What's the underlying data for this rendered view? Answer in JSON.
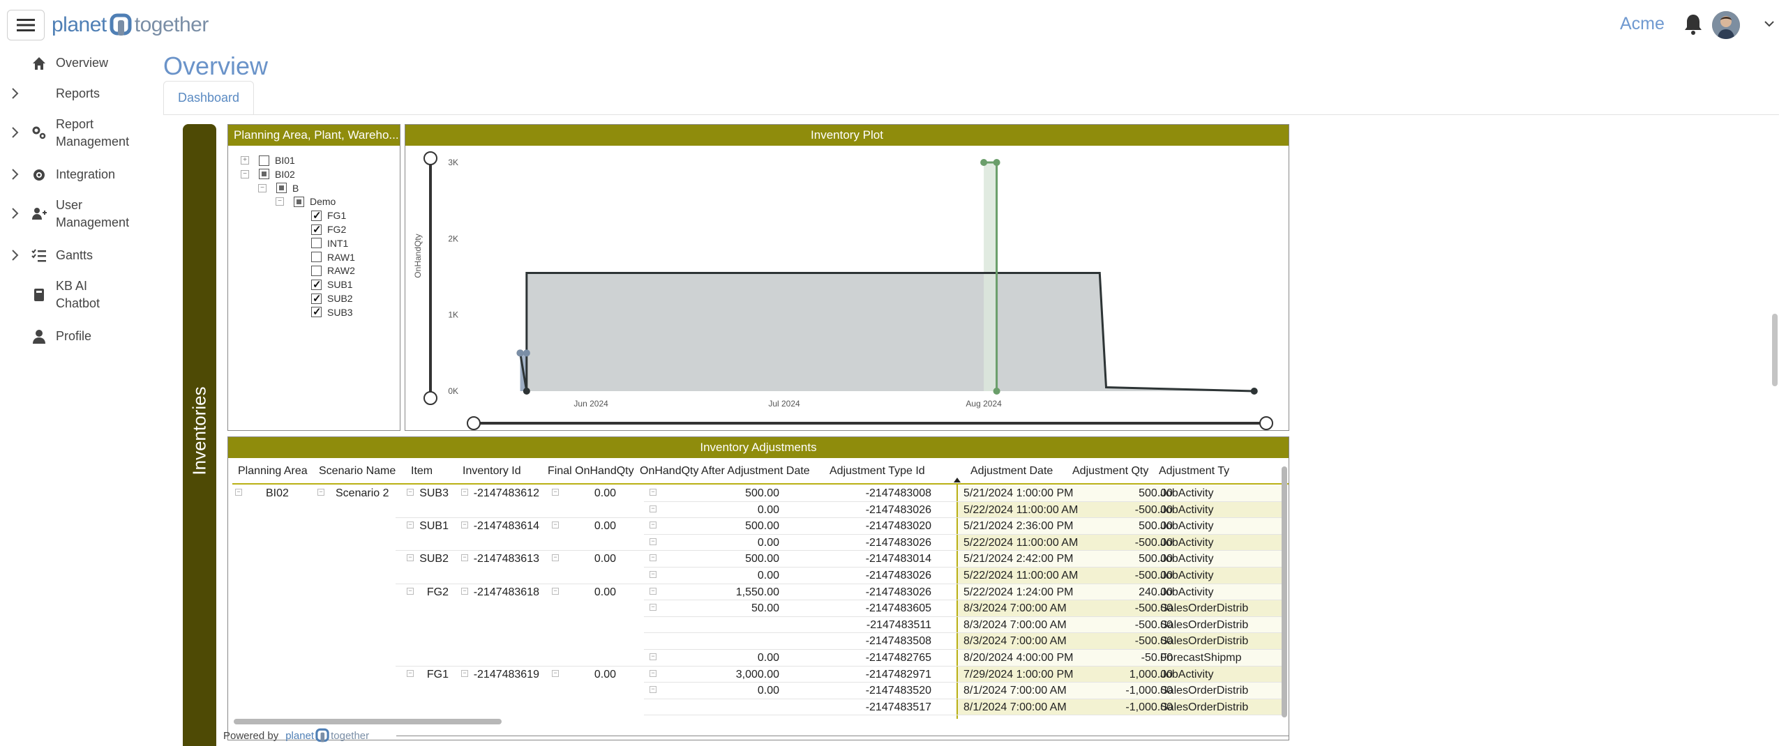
{
  "header": {
    "logo_left": "planet",
    "logo_right": "together",
    "org": "Acme"
  },
  "sidebar": {
    "items": [
      {
        "label": "Overview",
        "icon": "home-icon",
        "expandable": false
      },
      {
        "label": "Reports",
        "icon": "",
        "expandable": true
      },
      {
        "label": "Report\nManagement",
        "icon": "gears-icon",
        "expandable": true
      },
      {
        "label": "Integration",
        "icon": "gear-icon",
        "expandable": true
      },
      {
        "label": "User\nManagement",
        "icon": "user-plus-icon",
        "expandable": true
      },
      {
        "label": "Gantts",
        "icon": "list-check-icon",
        "expandable": true
      },
      {
        "label": "KB AI\nChatbot",
        "icon": "book-icon",
        "expandable": false
      },
      {
        "label": "Profile",
        "icon": "user-icon",
        "expandable": false
      }
    ]
  },
  "page": {
    "title": "Overview",
    "tab": "Dashboard",
    "side_label": "Inventories",
    "powered_by": "Powered by"
  },
  "filter_panel": {
    "title": "Planning Area, Plant, Wareho...",
    "tree": [
      {
        "label": "BI01",
        "level": 0,
        "toggle": "+",
        "state": "none"
      },
      {
        "label": "BI02",
        "level": 0,
        "toggle": "-",
        "state": "partial"
      },
      {
        "label": "B",
        "level": 1,
        "toggle": "-",
        "state": "partial"
      },
      {
        "label": "Demo",
        "level": 2,
        "toggle": "-",
        "state": "partial"
      },
      {
        "label": "FG1",
        "level": 3,
        "state": "checked"
      },
      {
        "label": "FG2",
        "level": 3,
        "state": "checked"
      },
      {
        "label": "INT1",
        "level": 3,
        "state": "none"
      },
      {
        "label": "RAW1",
        "level": 3,
        "state": "none"
      },
      {
        "label": "RAW2",
        "level": 3,
        "state": "none"
      },
      {
        "label": "SUB1",
        "level": 3,
        "state": "checked"
      },
      {
        "label": "SUB2",
        "level": 3,
        "state": "checked"
      },
      {
        "label": "SUB3",
        "level": 3,
        "state": "checked"
      }
    ]
  },
  "chart_panel": {
    "title": "Inventory Plot"
  },
  "chart_data": {
    "type": "area",
    "title": "Inventory Plot",
    "ylabel": "OnHandQty",
    "xlabel": "",
    "y_ticks": [
      "0K",
      "1K",
      "2K",
      "3K"
    ],
    "x_ticks": [
      "Jun 2024",
      "Jul 2024",
      "Aug 2024"
    ],
    "ylim": [
      0,
      3000
    ],
    "series": [
      {
        "color": "#2d3435",
        "fill": "#c5cacb",
        "points": [
          [
            "2024-05-21",
            500
          ],
          [
            "2024-05-22",
            0
          ],
          [
            "2024-05-22",
            1550
          ],
          [
            "2024-08-19",
            1550
          ],
          [
            "2024-08-20",
            50
          ],
          [
            "2024-09-12",
            0
          ]
        ]
      },
      {
        "color": "#6a9e6a",
        "fill": "#dce8dc",
        "points": [
          [
            "2024-08-01",
            3000
          ],
          [
            "2024-08-03",
            3000
          ],
          [
            "2024-08-03",
            0
          ]
        ]
      },
      {
        "color": "#7a8ea6",
        "fill": "#94a7c0",
        "points": [
          [
            "2024-05-21",
            500
          ],
          [
            "2024-05-22",
            500
          ]
        ]
      }
    ]
  },
  "table_panel": {
    "title": "Inventory Adjustments",
    "columns": [
      "Planning Area",
      "Scenario Name",
      "Item",
      "Inventory Id",
      "Final OnHandQty",
      "OnHandQty After Adjustment Date",
      "Adjustment Type Id",
      "Adjustment Date",
      "Adjustment Qty",
      "Adjustment Ty"
    ],
    "group": {
      "planning_area": "BI02",
      "scenario": "Scenario 2"
    },
    "items": [
      {
        "item": "SUB3",
        "inv_id": "-2147483612",
        "final": "0.00"
      },
      {
        "item": "SUB1",
        "inv_id": "-2147483614",
        "final": "0.00"
      },
      {
        "item": "SUB2",
        "inv_id": "-2147483613",
        "final": "0.00"
      },
      {
        "item": "FG2",
        "inv_id": "-2147483618",
        "final": "0.00"
      },
      {
        "item": "FG1",
        "inv_id": "-2147483619",
        "final": "0.00"
      }
    ],
    "rows": [
      {
        "after": "500.00",
        "type_id": "-2147483008",
        "date": "5/21/2024 1:00:00 PM",
        "qty": "500.00",
        "type": "JobActivity"
      },
      {
        "after": "0.00",
        "type_id": "-2147483026",
        "date": "5/22/2024 11:00:00 AM",
        "qty": "-500.00",
        "type": "JobActivity"
      },
      {
        "after": "500.00",
        "type_id": "-2147483020",
        "date": "5/21/2024 2:36:00 PM",
        "qty": "500.00",
        "type": "JobActivity"
      },
      {
        "after": "0.00",
        "type_id": "-2147483026",
        "date": "5/22/2024 11:00:00 AM",
        "qty": "-500.00",
        "type": "JobActivity"
      },
      {
        "after": "500.00",
        "type_id": "-2147483014",
        "date": "5/21/2024 2:42:00 PM",
        "qty": "500.00",
        "type": "JobActivity"
      },
      {
        "after": "0.00",
        "type_id": "-2147483026",
        "date": "5/22/2024 11:00:00 AM",
        "qty": "-500.00",
        "type": "JobActivity"
      },
      {
        "after": "1,550.00",
        "type_id": "-2147483026",
        "date": "5/22/2024 1:24:00 PM",
        "qty": "240.00",
        "type": "JobActivity"
      },
      {
        "after": "50.00",
        "type_id": "-2147483605",
        "date": "8/3/2024 7:00:00 AM",
        "qty": "-500.00",
        "type": "SalesOrderDistrib"
      },
      {
        "after": "",
        "type_id": "-2147483511",
        "date": "8/3/2024 7:00:00 AM",
        "qty": "-500.00",
        "type": "SalesOrderDistrib"
      },
      {
        "after": "",
        "type_id": "-2147483508",
        "date": "8/3/2024 7:00:00 AM",
        "qty": "-500.00",
        "type": "SalesOrderDistrib"
      },
      {
        "after": "0.00",
        "type_id": "-2147482765",
        "date": "8/20/2024 4:00:00 PM",
        "qty": "-50.00",
        "type": "ForecastShipmp"
      },
      {
        "after": "3,000.00",
        "type_id": "-2147482971",
        "date": "7/29/2024 1:00:00 PM",
        "qty": "1,000.00",
        "type": "JobActivity"
      },
      {
        "after": "0.00",
        "type_id": "-2147483520",
        "date": "8/1/2024 7:00:00 AM",
        "qty": "-1,000.00",
        "type": "SalesOrderDistrib"
      },
      {
        "after": "",
        "type_id": "-2147483517",
        "date": "8/1/2024 7:00:00 AM",
        "qty": "-1,000.00",
        "type": "SalesOrderDistrib"
      }
    ]
  }
}
